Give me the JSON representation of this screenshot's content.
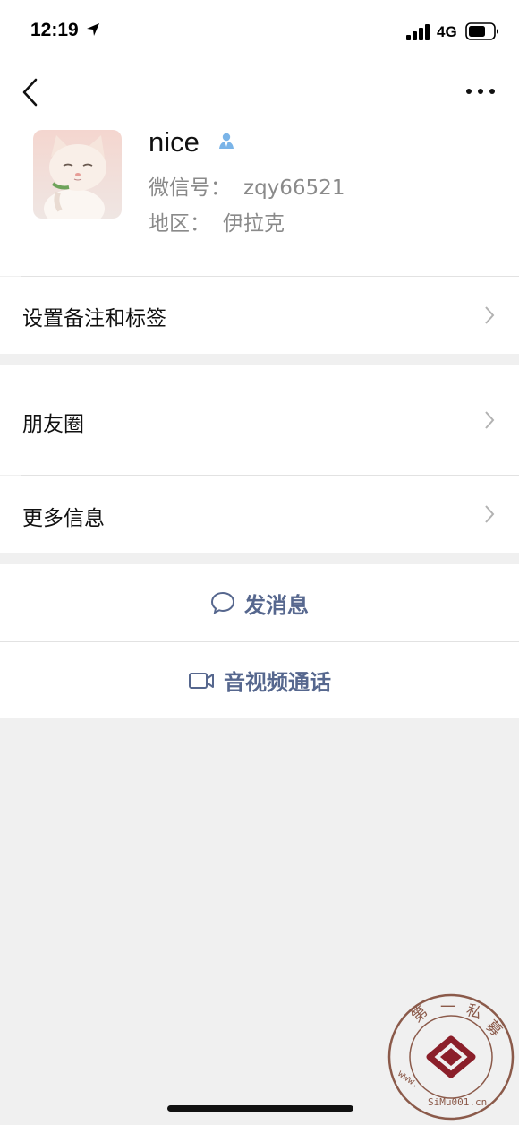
{
  "status_bar": {
    "time": "12:19",
    "network": "4G",
    "icons": [
      "location-arrow-icon",
      "signal-bars-icon",
      "battery-icon"
    ]
  },
  "nav": {
    "back_icon": "chevron-left-icon",
    "more_icon": "ellipsis-icon"
  },
  "profile": {
    "name": "nice",
    "wechat_label": "微信号：",
    "wechat_id": "zqy66521",
    "region_label": "地区：",
    "region": "伊拉克",
    "verified_icon": "person-verified-icon"
  },
  "rows": {
    "remark": "设置备注和标签",
    "moments": "朋友圈",
    "more_info": "更多信息"
  },
  "actions": {
    "message": "发消息",
    "call": "音视频通话"
  },
  "watermark": {
    "chars": [
      "第",
      "一",
      "私",
      "募"
    ],
    "url": "www.SiMu001.cn"
  },
  "colors": {
    "action_text": "#56678e",
    "background": "#f0f0f0",
    "surface": "#ffffff",
    "secondary_text": "#8a8a8a"
  }
}
